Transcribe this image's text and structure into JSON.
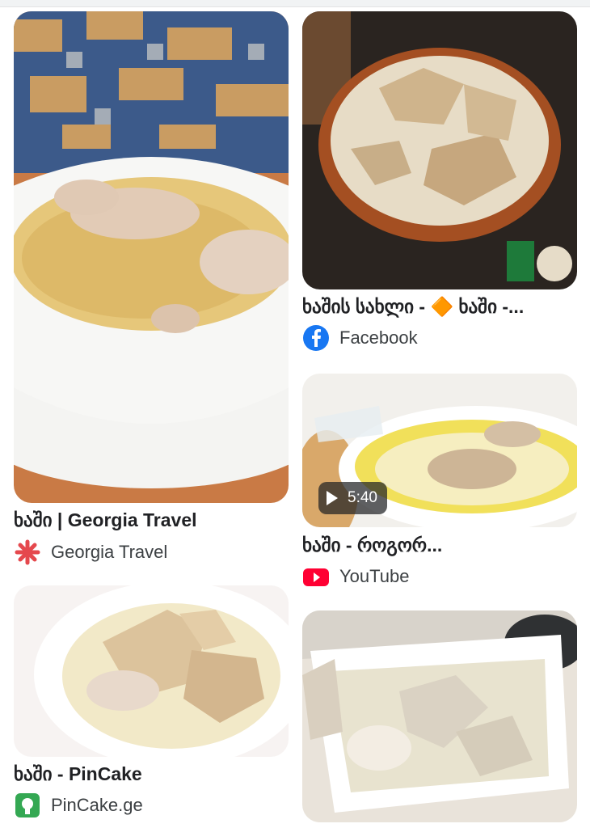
{
  "results": [
    {
      "title": "ხაში | Georgia Travel",
      "source": "Georgia Travel",
      "icon": "georgia-travel-icon"
    },
    {
      "title": "ხაშის სახლი - 🔶 ხაში -...",
      "source": "Facebook",
      "icon": "facebook-icon"
    },
    {
      "title": "ხაში - როგორ...",
      "source": "YouTube",
      "icon": "youtube-icon",
      "duration": "5:40"
    },
    {
      "title": "ხაში - PinCake",
      "source": "PinCake.ge",
      "icon": "pincake-icon"
    }
  ]
}
